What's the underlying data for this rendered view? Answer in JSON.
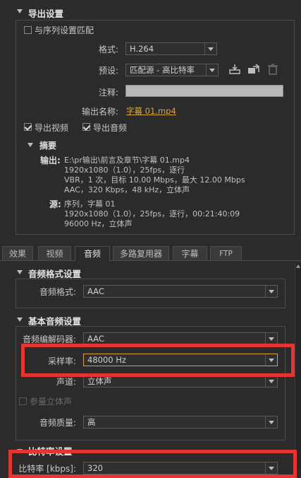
{
  "export_settings": {
    "header": "导出设置",
    "match_sequence": "与序列设置匹配",
    "format_label": "格式:",
    "format_value": "H.264",
    "preset_label": "预设:",
    "preset_value": "匹配源 - 高比特率",
    "comment_label": "注释:",
    "output_name_label": "输出名称:",
    "output_name_value": "字幕 01.mp4",
    "export_video": "导出视频",
    "export_audio": "导出音频"
  },
  "summary": {
    "header": "摘要",
    "output_label": "输出:",
    "output_lines": [
      "E:\\pr输出\\前言及章节\\字幕 01.mp4",
      "1920x1080（1.0），25fps，逐行",
      "VBR，1 次，目标 10.00 Mbps，最大 12.00 Mbps",
      "AAC，320 Kbps，48 kHz，立体声"
    ],
    "source_label": "源:",
    "source_lines": [
      "序列，字幕 01",
      "1920x1080（1.0），25fps，逐行，00:21:40:09",
      "96000 Hz，立体声"
    ]
  },
  "tabs": [
    "效果",
    "视频",
    "音频",
    "多路复用器",
    "字幕",
    "FTP"
  ],
  "audio_format_settings": {
    "header": "音频格式设置",
    "format_label": "音频格式:",
    "format_value": "AAC"
  },
  "basic_audio_settings": {
    "header": "基本音频设置",
    "codec_label": "音频编解码器:",
    "codec_value": "AAC",
    "sample_rate_label": "采样率:",
    "sample_rate_value": "48000 Hz",
    "channels_label": "声道:",
    "channels_value": "立体声",
    "parametric_stereo": "参量立体声",
    "quality_label": "音频质量:",
    "quality_value": "高"
  },
  "bitrate_settings": {
    "header": "比特率设置",
    "bitrate_label": "比特率 [kbps]:",
    "bitrate_value": "320"
  },
  "colors": {
    "highlight": "#e63434",
    "link": "#d9a53a",
    "panel": "#2b2b2b"
  },
  "icons": [
    "save-preset-icon",
    "import-preset-icon",
    "delete-preset-icon"
  ]
}
